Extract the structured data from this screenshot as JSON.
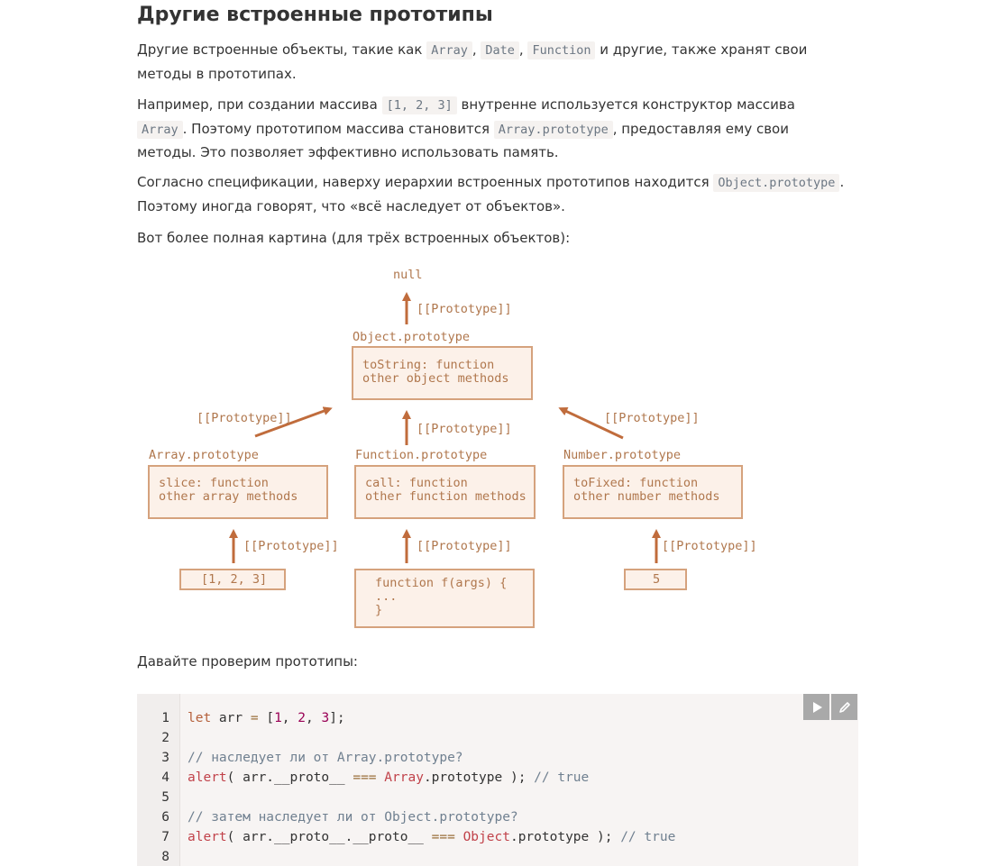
{
  "heading": "Другие встроенные прототипы",
  "para1": {
    "t1": "Другие встроенные объекты, такие как ",
    "c1": "Array",
    "t2": ", ",
    "c2": "Date",
    "t3": ", ",
    "c3": "Function",
    "t4": " и другие, также хранят свои методы в прототипах."
  },
  "para2": {
    "t1": "Например, при создании массива ",
    "c1": "[1, 2, 3]",
    "t2": " внутренне используется конструктор массива ",
    "c2": "Array",
    "t3": ". Поэтому прототипом массива становится ",
    "c3": "Array.prototype",
    "t4": ", предоставляя ему свои методы. Это позволяет эффективно использовать память."
  },
  "para3": {
    "t1": "Согласно спецификации, наверху иерархии встроенных прототипов находится ",
    "c1": "Object.prototype",
    "t2": ". Поэтому иногда говорят, что «всё наследует от объектов»."
  },
  "para4": "Вот более полная картина (для трёх встроенных объектов):",
  "diagram": {
    "null_label": "null",
    "proto_label": "[[Prototype]]",
    "object_proto": {
      "title": "Object.prototype",
      "line1": "toString: function",
      "line2": "other object methods"
    },
    "array_proto": {
      "title": "Array.prototype",
      "line1": "slice: function",
      "line2": "other array methods"
    },
    "function_proto": {
      "title": "Function.prototype",
      "line1": "call: function",
      "line2": "other function methods"
    },
    "number_proto": {
      "title": "Number.prototype",
      "line1": "toFixed: function",
      "line2": "other number methods"
    },
    "array_instance": "[1, 2, 3]",
    "function_instance": {
      "line1": "function f(args) {",
      "line2": "...",
      "line3": "}"
    },
    "number_instance": "5",
    "colors": {
      "stroke": "#d5a27d",
      "fill": "#fcf1e9",
      "arrow": "#c06c3c",
      "text": "#b0774d"
    }
  },
  "para5": "Давайте проверим прототипы:",
  "code": {
    "run_icon": "play-icon",
    "edit_icon": "pencil-icon",
    "lines": [
      {
        "n": "1",
        "parts": [
          [
            "kw",
            "let"
          ],
          [
            "",
            " arr "
          ],
          [
            "op",
            "="
          ],
          [
            "",
            " ["
          ],
          [
            "num",
            "1"
          ],
          [
            "",
            ", "
          ],
          [
            "num",
            "2"
          ],
          [
            "",
            ", "
          ],
          [
            "num",
            "3"
          ],
          [
            "",
            "];"
          ]
        ]
      },
      {
        "n": "2",
        "parts": []
      },
      {
        "n": "3",
        "parts": [
          [
            "cm",
            "// наследует ли от Array.prototype?"
          ]
        ]
      },
      {
        "n": "4",
        "parts": [
          [
            "fn",
            "alert"
          ],
          [
            "",
            "( arr.__proto__ "
          ],
          [
            "op",
            "==="
          ],
          [
            "",
            " "
          ],
          [
            "cls",
            "Array"
          ],
          [
            "",
            ".prototype ); "
          ],
          [
            "cm",
            "// true"
          ]
        ]
      },
      {
        "n": "5",
        "parts": []
      },
      {
        "n": "6",
        "parts": [
          [
            "cm",
            "// затем наследует ли от Object.prototype?"
          ]
        ]
      },
      {
        "n": "7",
        "parts": [
          [
            "fn",
            "alert"
          ],
          [
            "",
            "( arr.__proto__.__proto__ "
          ],
          [
            "op",
            "==="
          ],
          [
            "",
            " "
          ],
          [
            "cls",
            "Object"
          ],
          [
            "",
            ".prototype ); "
          ],
          [
            "cm",
            "// true"
          ]
        ]
      },
      {
        "n": "8",
        "parts": []
      }
    ]
  }
}
